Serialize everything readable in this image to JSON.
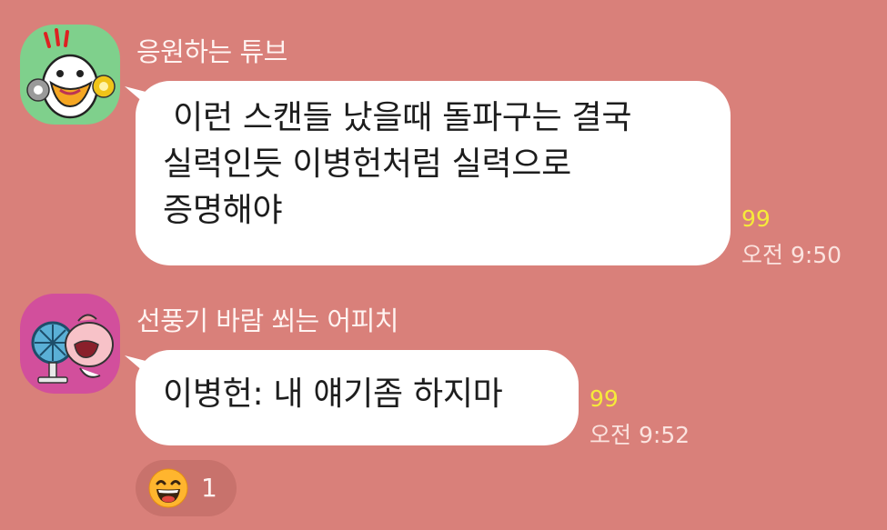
{
  "messages": [
    {
      "sender": "응원하는 튜브",
      "avatar_icon": "tube-cheering-duck-icon",
      "avatar_bg": "#7fd08c",
      "text": " 이런 스캔들 났을때 돌파구는 결국\n실력인듯 이병헌처럼 실력으로\n증명해야",
      "unread": "99",
      "time": "오전 9:50"
    },
    {
      "sender": "선풍기 바람 쐬는 어피치",
      "avatar_icon": "apeach-fan-icon",
      "avatar_bg": "#d24f9c",
      "text": "이병헌: 내 얘기좀 하지마",
      "unread": "99",
      "time": "오전 9:52"
    }
  ],
  "reaction": {
    "icon": "grinning-face-emoji-icon",
    "count": "1"
  },
  "colors": {
    "background": "#d9807a",
    "bubble": "#ffffff",
    "unread": "#f6ea3a"
  }
}
